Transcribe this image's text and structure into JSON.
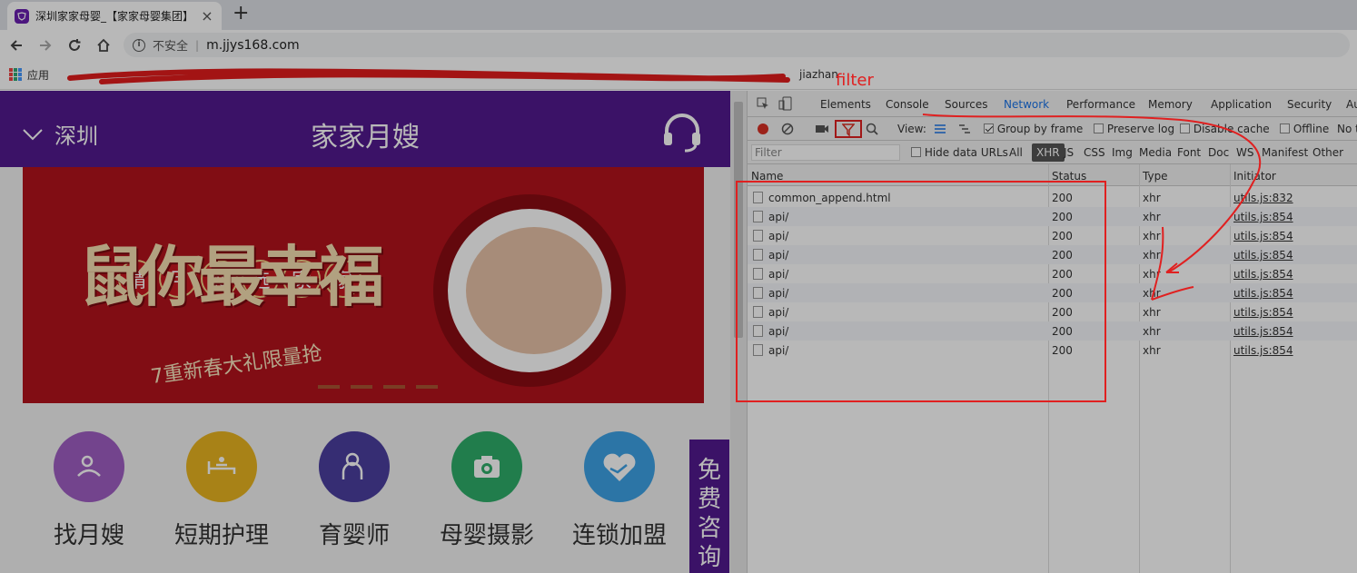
{
  "browser": {
    "tab_title": "深圳家家母婴_【家家母婴集团】",
    "new_tab_glyph": "+",
    "close_glyph": "×",
    "security_label": "不安全",
    "url_separator": "|",
    "url": "m.jjys168.com"
  },
  "bookmarks": {
    "apps_label": "应用",
    "last_item": "jiazhan"
  },
  "site": {
    "city": "深圳",
    "title": "家家月嫂",
    "banner_slogan": [
      "请",
      "月",
      "嫂",
      "选",
      "家",
      "家"
    ],
    "banner_headline": "鼠你最幸福",
    "banner_promo": "7重新春大礼限量抢",
    "features": [
      {
        "label": "找月嫂",
        "color": "#a05fc4"
      },
      {
        "label": "短期护理",
        "color": "#e9b520"
      },
      {
        "label": "育婴师",
        "color": "#4b3fa0"
      },
      {
        "label": "母婴摄影",
        "color": "#2fae6a"
      },
      {
        "label": "连锁加盟",
        "color": "#3ea2e6"
      }
    ],
    "consult_label": "免费咨询"
  },
  "devtools": {
    "tabs": [
      "Elements",
      "Console",
      "Sources",
      "Network",
      "Performance",
      "Memory",
      "Application",
      "Security",
      "Au"
    ],
    "active_tab": "Network",
    "toolbar": {
      "view_label": "View:",
      "group_by_frame": "Group by frame",
      "preserve_log": "Preserve log",
      "disable_cache": "Disable cache",
      "offline": "Offline",
      "no_throttling": "No t"
    },
    "filter": {
      "placeholder": "Filter",
      "hide_data_urls": "Hide data URLs",
      "types": [
        "All",
        "XHR",
        "JS",
        "CSS",
        "Img",
        "Media",
        "Font",
        "Doc",
        "WS",
        "Manifest",
        "Other"
      ],
      "active_type": "XHR"
    },
    "columns": [
      "Name",
      "Status",
      "Type",
      "Initiator"
    ],
    "rows": [
      {
        "name": "common_append.html",
        "status": "200",
        "type": "xhr",
        "initiator": "utils.js:832"
      },
      {
        "name": "api/",
        "status": "200",
        "type": "xhr",
        "initiator": "utils.js:854"
      },
      {
        "name": "api/",
        "status": "200",
        "type": "xhr",
        "initiator": "utils.js:854"
      },
      {
        "name": "api/",
        "status": "200",
        "type": "xhr",
        "initiator": "utils.js:854"
      },
      {
        "name": "api/",
        "status": "200",
        "type": "xhr",
        "initiator": "utils.js:854"
      },
      {
        "name": "api/",
        "status": "200",
        "type": "xhr",
        "initiator": "utils.js:854"
      },
      {
        "name": "api/",
        "status": "200",
        "type": "xhr",
        "initiator": "utils.js:854"
      },
      {
        "name": "api/",
        "status": "200",
        "type": "xhr",
        "initiator": "utils.js:854"
      },
      {
        "name": "api/",
        "status": "200",
        "type": "xhr",
        "initiator": "utils.js:854"
      }
    ]
  },
  "annotation": {
    "label": "filter",
    "color": "#e02020"
  }
}
